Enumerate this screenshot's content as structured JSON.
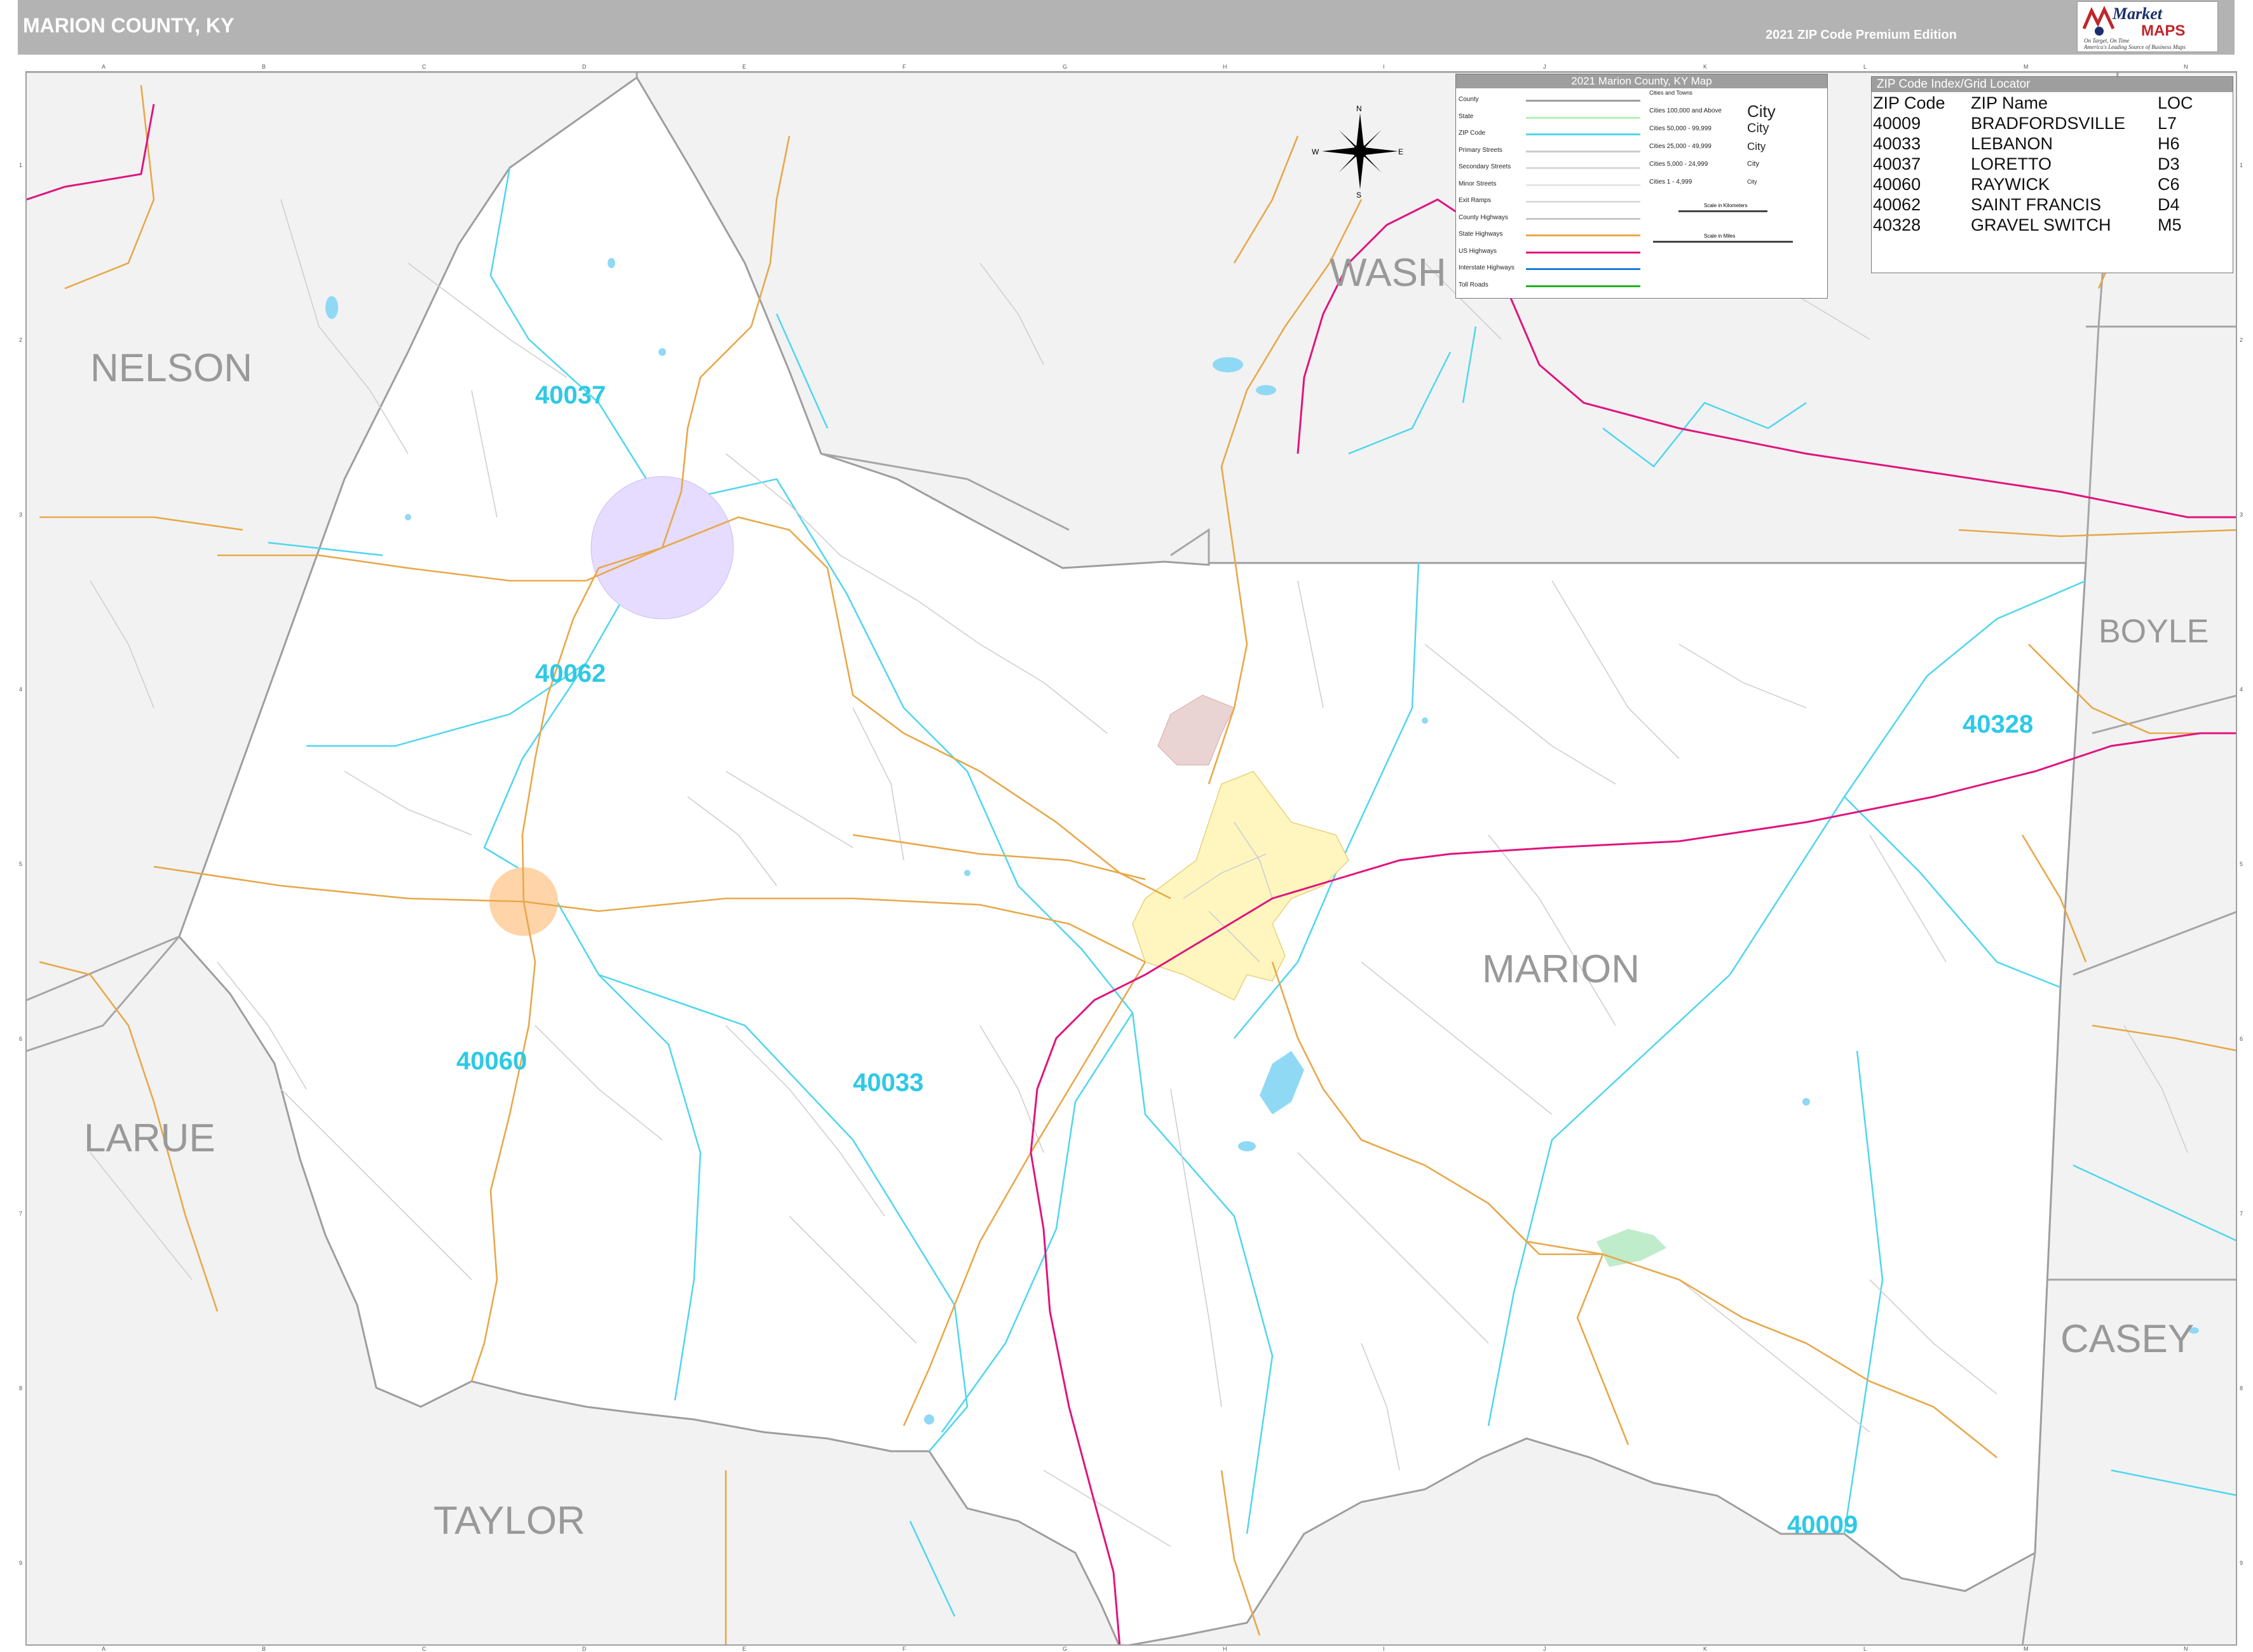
{
  "header": {
    "title": "MARION COUNTY, KY",
    "edition": "2021 ZIP Code Premium Edition"
  },
  "logo": {
    "market": "Market",
    "maps": "MAPS",
    "tagline_1": "On Target, On Time",
    "tagline_2": "America's Leading Source of Business Maps"
  },
  "compass": {
    "n": "N",
    "s": "S",
    "e": "E",
    "w": "W"
  },
  "grid": {
    "columns": [
      "A",
      "B",
      "C",
      "D",
      "E",
      "F",
      "G",
      "H",
      "I",
      "J",
      "K",
      "L",
      "M",
      "N"
    ],
    "rows": [
      "1",
      "2",
      "3",
      "4",
      "5",
      "6",
      "7",
      "8",
      "9"
    ]
  },
  "legend": {
    "title": "2021 Marion County, KY Map",
    "items": [
      {
        "label": "County",
        "color": "#9e9e9e"
      },
      {
        "label": "State",
        "color": "#b6f0b6"
      },
      {
        "label": "ZIP Code",
        "color": "#4fd6ee"
      },
      {
        "label": "Primary Streets",
        "color": "#cccccc"
      },
      {
        "label": "Secondary Streets",
        "color": "#d9d9d9"
      },
      {
        "label": "Minor Streets",
        "color": "#e6e6e6"
      },
      {
        "label": "Exit Ramps",
        "color": "#dddddd"
      },
      {
        "label": "County Highways",
        "color": "#c8c8c8"
      },
      {
        "label": "State Highways",
        "color": "#e8a84a"
      },
      {
        "label": "US Highways",
        "color": "#e0147e"
      },
      {
        "label": "Interstate Highways",
        "color": "#1f7fd6"
      },
      {
        "label": "Toll Roads",
        "color": "#1fb31f"
      }
    ],
    "cities_heading": "Cities and Towns",
    "cities": [
      {
        "label": "Cities 100,000 and Above",
        "mark": "City"
      },
      {
        "label": "Cities 50,000 - 99,999",
        "mark": "City"
      },
      {
        "label": "Cities 25,000 - 49,999",
        "mark": "City"
      },
      {
        "label": "Cities 5,000 - 24,999",
        "mark": "City"
      },
      {
        "label": "Cities 1 - 4,999",
        "mark": "City"
      }
    ],
    "scale_km": "Scale in Kilometers",
    "scale_mi": "Scale in Miles"
  },
  "zip_index": {
    "title": "ZIP Code Index/Grid Locator",
    "headers": [
      "ZIP Code",
      "ZIP Name",
      "LOC"
    ],
    "rows": [
      [
        "40009",
        "BRADFORDSVILLE",
        "L7"
      ],
      [
        "40033",
        "LEBANON",
        "H6"
      ],
      [
        "40037",
        "LORETTO",
        "D3"
      ],
      [
        "40060",
        "RAYWICK",
        "C6"
      ],
      [
        "40062",
        "SAINT FRANCIS",
        "D4"
      ],
      [
        "40328",
        "GRAVEL SWITCH",
        "M5"
      ]
    ]
  },
  "regions": {
    "nelson": "NELSON",
    "wash": "WASH",
    "boyle": "BOYLE",
    "marion": "MARION",
    "larue": "LARUE",
    "casey": "CASEY",
    "taylor": "TAYLOR"
  },
  "zips": {
    "z40037": "40037",
    "z40062": "40062",
    "z40060": "40060",
    "z40033": "40033",
    "z40328": "40328",
    "z40009": "40009"
  },
  "colors": {
    "outside": "#f2f2f2",
    "county_fill": "#ffffff",
    "county_border": "#9e9e9e",
    "zip_line": "#4fd6ee",
    "state_hwy": "#e8a84a",
    "us_hwy": "#e0147e",
    "minor_road": "#cfcfcf",
    "water": "#8fd9f5",
    "lebanon_area": "#fff6bf",
    "loretto_area": "#e5dcff",
    "raywick_area": "#ffd4a8",
    "bradfordsville_area": "#bfeccb"
  }
}
